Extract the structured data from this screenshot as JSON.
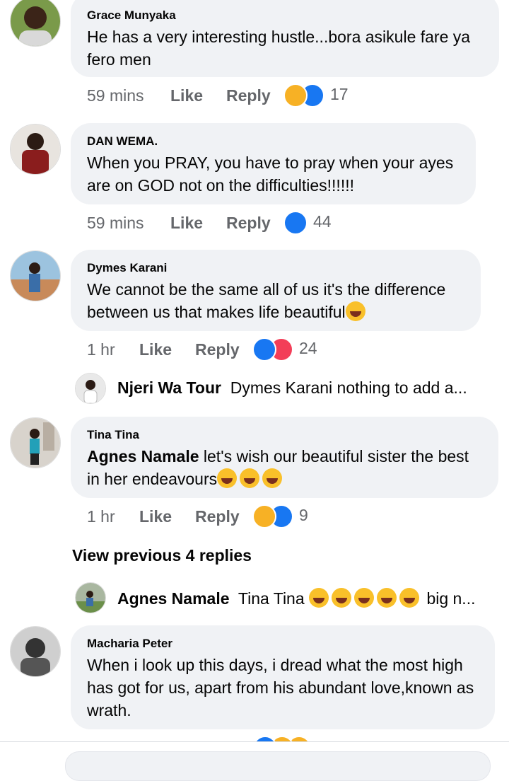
{
  "comments": [
    {
      "author": "Grace Munyaka",
      "text": "He has a very interesting hustle...bora asikule fare ya fero men",
      "time": "59 mins",
      "like": "Like",
      "reply": "Reply",
      "reactions": "17"
    },
    {
      "author": "DAN WEMA.",
      "text": "When you PRAY, you have to pray when your ayes are on GOD not on the difficulties!!!!!!",
      "time": "59 mins",
      "like": "Like",
      "reply": "Reply",
      "reactions": "44"
    },
    {
      "author": "Dymes Karani",
      "text": "We cannot be the same all of us it's the difference between us that makes life beautiful",
      "time": "1 hr",
      "like": "Like",
      "reply": "Reply",
      "reactions": "24"
    },
    {
      "author": "Tina  Tina",
      "mention": "Agnes Namale",
      "text": " let's wish our beautiful sister the best in her endeavours",
      "time": "1 hr",
      "like": "Like",
      "reply": "Reply",
      "reactions": "9"
    },
    {
      "author": "Macharia Peter",
      "text": "When i look up this days, i dread what the most high has got for us, apart from his abundant love,known as wrath."
    }
  ],
  "replies": [
    {
      "author": "Njeri Wa Tour",
      "text": "Dymes Karani nothing to add a..."
    },
    {
      "author": "Agnes Namale",
      "text": "Tina  Tina",
      "tail": "big n..."
    }
  ],
  "view_previous": "View previous 4 replies",
  "colors": {
    "like": "#1877f2",
    "love": "#f33e58",
    "haha": "#f7b125",
    "bubble": "#f0f2f5",
    "meta": "#65676b"
  }
}
